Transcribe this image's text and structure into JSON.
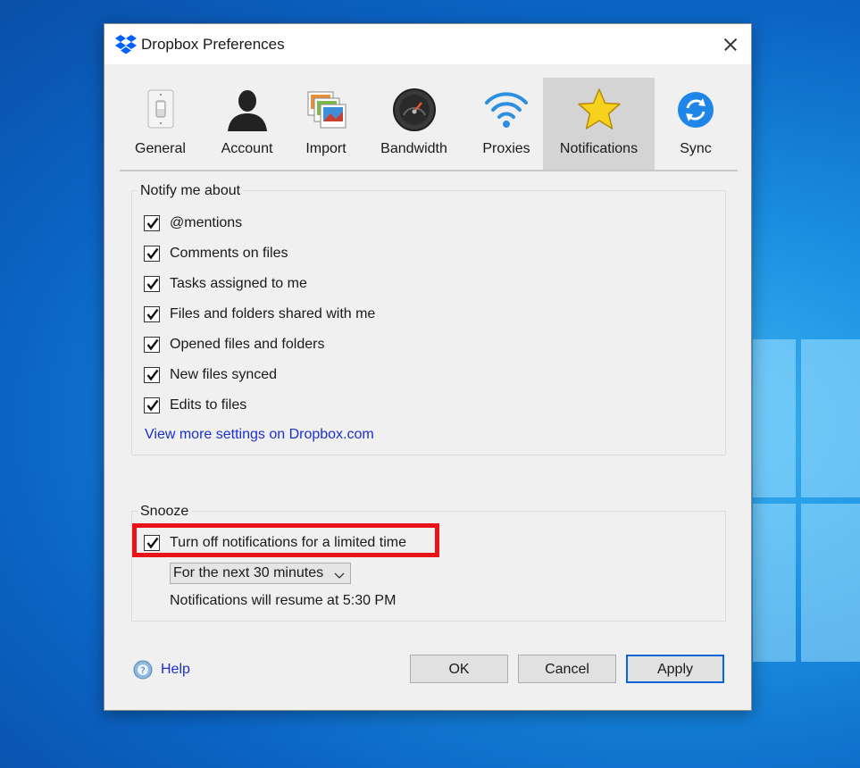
{
  "window": {
    "title": "Dropbox Preferences"
  },
  "tabs": [
    {
      "label": "General",
      "icon": "light-switch-icon"
    },
    {
      "label": "Account",
      "icon": "user-silhouette-icon"
    },
    {
      "label": "Import",
      "icon": "photos-import-icon"
    },
    {
      "label": "Bandwidth",
      "icon": "speedometer-icon"
    },
    {
      "label": "Proxies",
      "icon": "wifi-icon"
    },
    {
      "label": "Notifications",
      "icon": "star-icon",
      "active": true
    },
    {
      "label": "Sync",
      "icon": "sync-icon"
    }
  ],
  "notify": {
    "group_label": "Notify me about",
    "items": [
      {
        "label": "@mentions",
        "checked": true
      },
      {
        "label": "Comments on files",
        "checked": true
      },
      {
        "label": "Tasks assigned to me",
        "checked": true
      },
      {
        "label": "Files and folders shared with me",
        "checked": true
      },
      {
        "label": "Opened files and folders",
        "checked": true
      },
      {
        "label": "New files synced",
        "checked": true
      },
      {
        "label": "Edits to files",
        "checked": true
      }
    ],
    "link": "View more settings on Dropbox.com"
  },
  "snooze": {
    "group_label": "Snooze",
    "toggle_label": "Turn off notifications for a limited time",
    "toggle_checked": true,
    "duration": "For the next 30 minutes",
    "resume_text": "Notifications will resume at 5:30 PM"
  },
  "footer": {
    "help_label": "Help",
    "ok_label": "OK",
    "cancel_label": "Cancel",
    "apply_label": "Apply"
  },
  "colors": {
    "accent_blue": "#0a64d6",
    "link_blue": "#1a2fd0",
    "highlight_red": "#e8141a",
    "dropbox_blue": "#0061fe"
  }
}
